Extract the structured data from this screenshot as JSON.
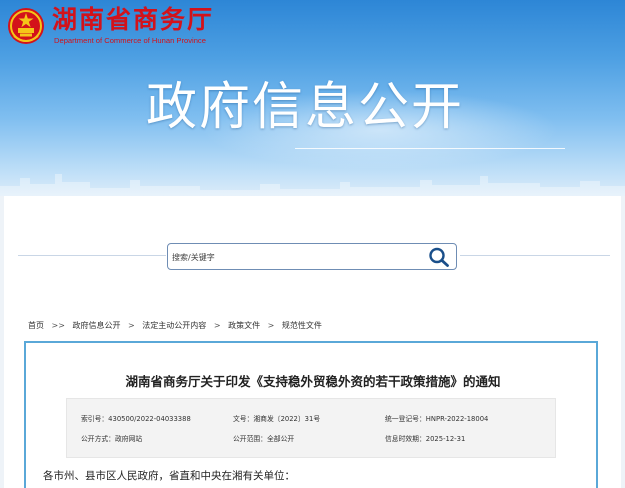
{
  "header": {
    "site_name": "湖南省商务厅",
    "site_name_en": "Department of Commerce of Hunan Province",
    "page_title": "政府信息公开",
    "emblem_icon": "national-emblem-icon",
    "brand_red": "#d3121a"
  },
  "search": {
    "placeholder": "搜索/关键字",
    "button_icon": "search-icon"
  },
  "breadcrumb": {
    "items": [
      "首页",
      "政府信息公开",
      "法定主动公开内容",
      "政策文件",
      "规范性文件"
    ],
    "separators": [
      ">>",
      ">",
      ">",
      ">"
    ]
  },
  "document": {
    "title": "湖南省商务厅关于印发《支持稳外贸稳外资的若干政策措施》的通知",
    "meta": {
      "index_no": "索引号：430500/2022-04033388",
      "doc_no": "文号：湘商发〔2022〕31号",
      "unified_no": "统一登记号：HNPR-2022-18004",
      "publish_method": "公开方式：政府网站",
      "publish_scope": "公开范围：全部公开",
      "valid_until": "信息时效期：2025-12-31"
    },
    "salutation": "各市州、县市区人民政府，省直和中央在湘有关单位："
  }
}
